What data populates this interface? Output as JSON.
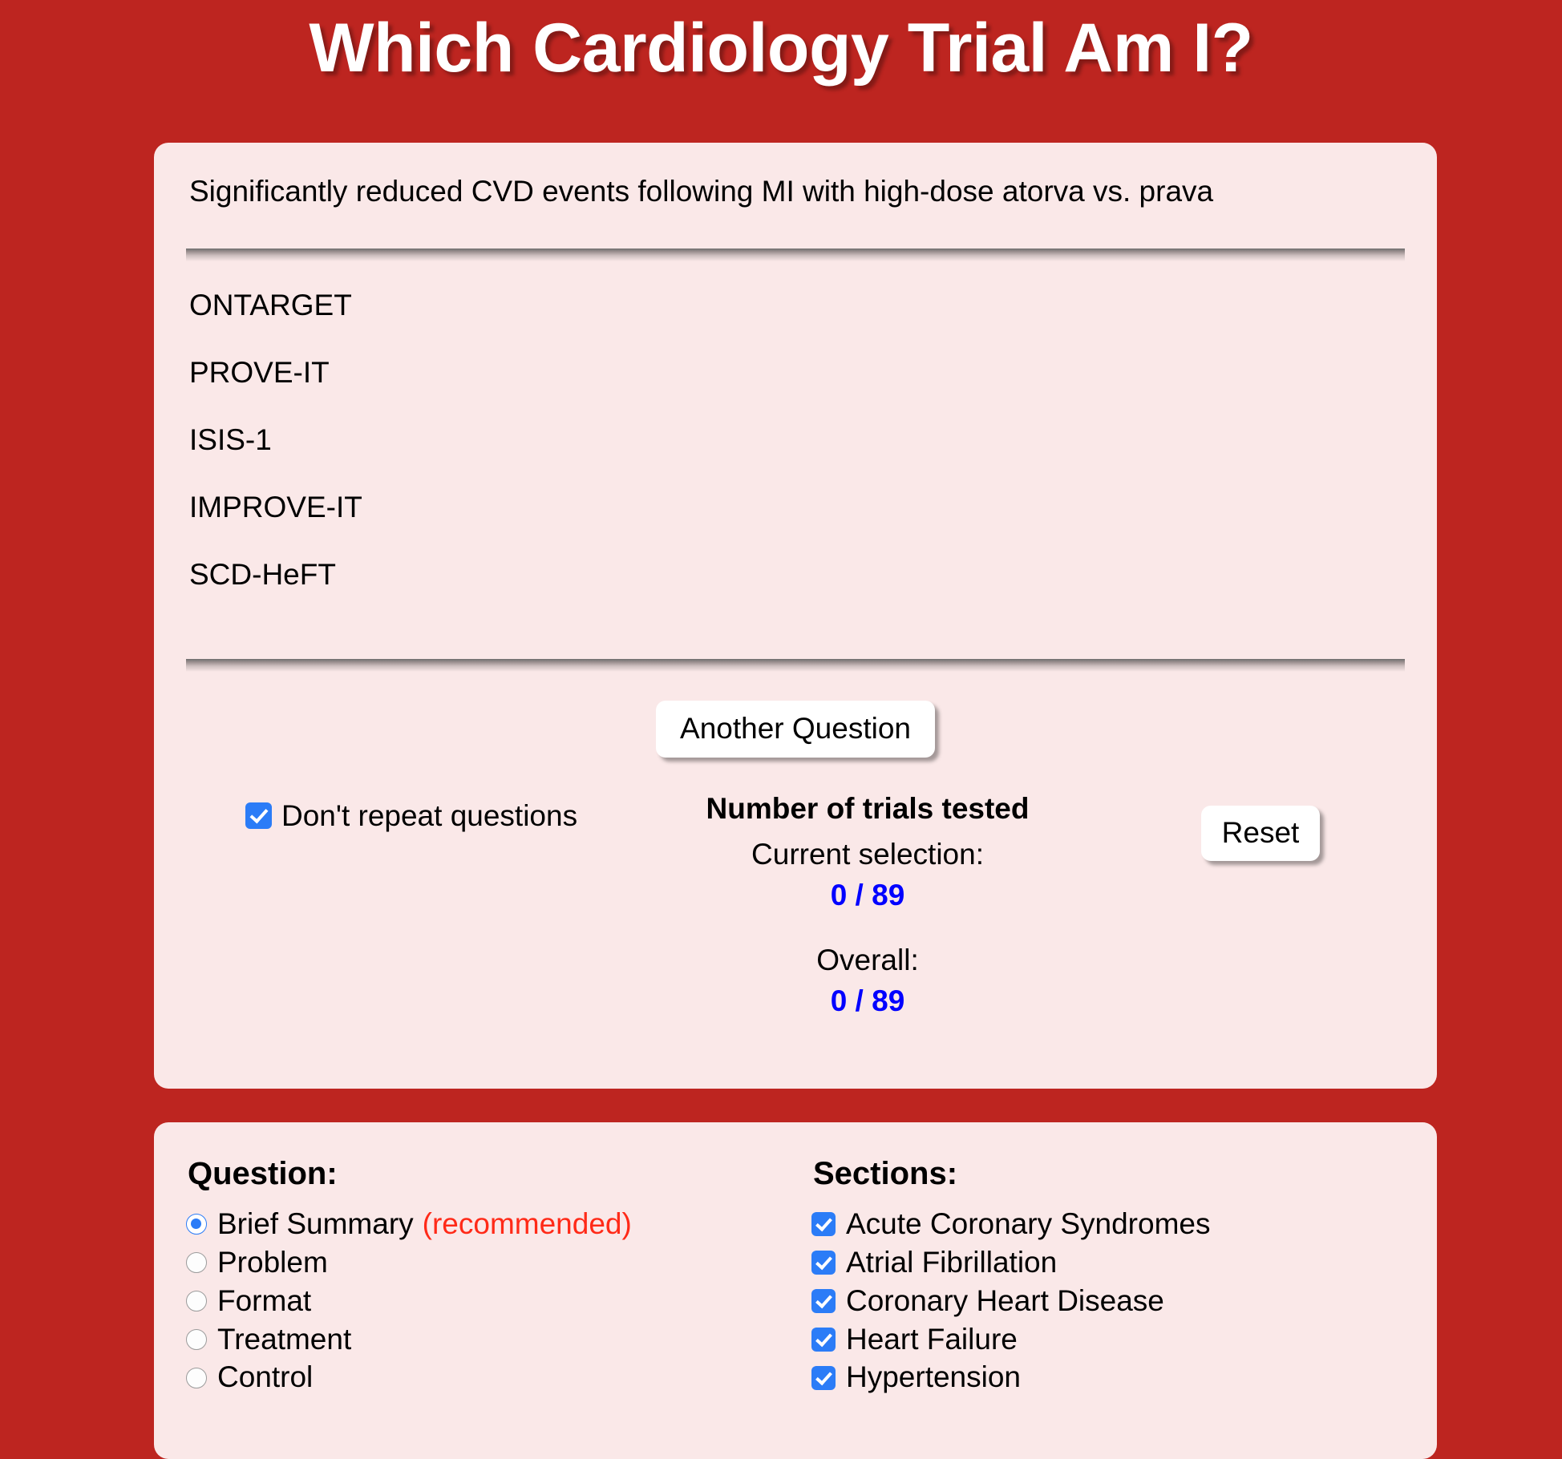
{
  "header": {
    "title": "Which Cardiology Trial Am I?"
  },
  "quiz": {
    "prompt": "Significantly reduced CVD events following MI with high-dose atorva vs. prava",
    "answers": [
      "ONTARGET",
      "PROVE-IT",
      "ISIS-1",
      "IMPROVE-IT",
      "SCD-HeFT"
    ],
    "another_question_label": "Another Question",
    "reset_label": "Reset",
    "dont_repeat": {
      "label": "Don't repeat questions",
      "checked": true
    },
    "stats": {
      "title": "Number of trials tested",
      "current_selection_label": "Current selection:",
      "current_selection_value": "0 / 89",
      "overall_label": "Overall:",
      "overall_value": "0 / 89"
    }
  },
  "settings": {
    "question": {
      "heading": "Question:",
      "options": [
        {
          "label": "Brief Summary",
          "note": "(recommended)",
          "selected": true
        },
        {
          "label": "Problem",
          "note": "",
          "selected": false
        },
        {
          "label": "Format",
          "note": "",
          "selected": false
        },
        {
          "label": "Treatment",
          "note": "",
          "selected": false
        },
        {
          "label": "Control",
          "note": "",
          "selected": false
        }
      ]
    },
    "sections": {
      "heading": "Sections:",
      "options": [
        {
          "label": "Acute Coronary Syndromes",
          "checked": true
        },
        {
          "label": "Atrial Fibrillation",
          "checked": true
        },
        {
          "label": "Coronary Heart Disease",
          "checked": true
        },
        {
          "label": "Heart Failure",
          "checked": true
        },
        {
          "label": "Hypertension",
          "checked": true
        }
      ]
    }
  },
  "colors": {
    "background_red": "#bd2520",
    "card_pink": "#fae8e8",
    "accent_blue": "#2b7cf7",
    "value_blue": "#0000ff",
    "note_red": "#ff2a18"
  }
}
